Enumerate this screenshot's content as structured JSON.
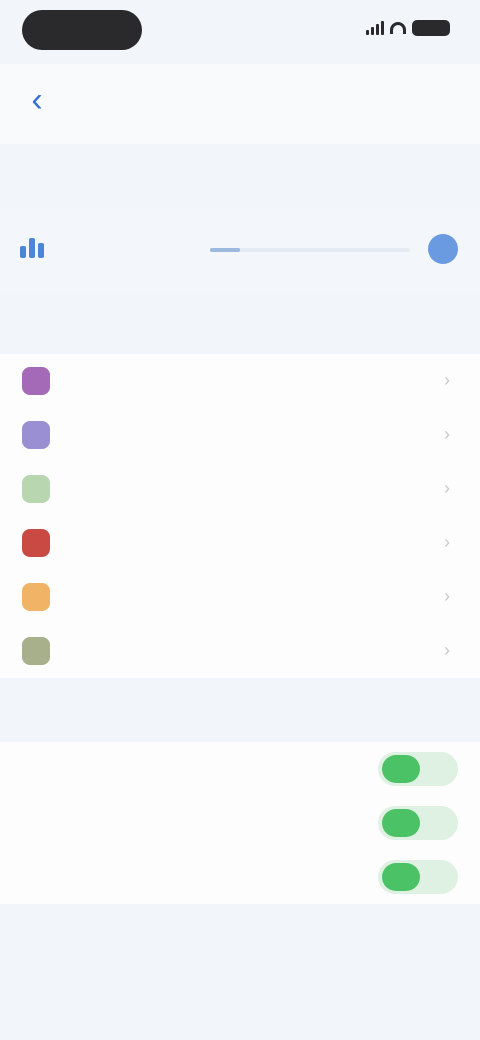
{
  "status_bar": {
    "time": "",
    "battery": ""
  },
  "nav": {
    "title": "",
    "back_label": "‹"
  },
  "storage": {
    "section_title": "",
    "used": "",
    "used_fraction": 0.15
  },
  "apps": {
    "section_title": "",
    "items": [
      {
        "name": "",
        "size": "",
        "color": "#a46ab8"
      },
      {
        "name": "",
        "size": "",
        "color": "#9a8fd2"
      },
      {
        "name": "",
        "size": "",
        "color": "#b8d6b0"
      },
      {
        "name": "",
        "size": "",
        "color": "#c84a42"
      },
      {
        "name": "",
        "size": "",
        "color": "#f1b366"
      },
      {
        "name": "",
        "size": "",
        "color": "#a7b08a"
      }
    ]
  },
  "settings": {
    "section_title": "",
    "toggles": [
      {
        "label": "",
        "on": true
      },
      {
        "label": "",
        "on": true
      },
      {
        "label": "",
        "on": true
      }
    ]
  }
}
